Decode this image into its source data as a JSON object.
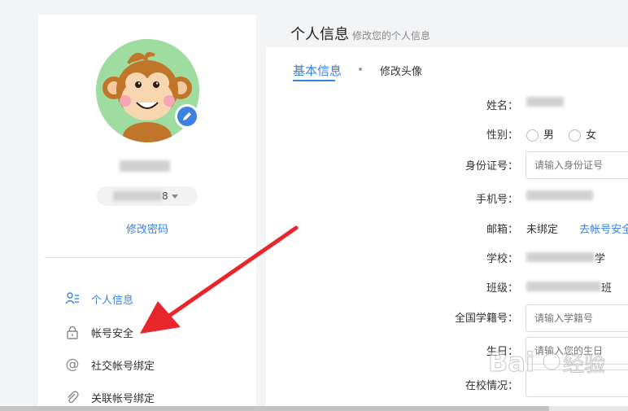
{
  "sidebar": {
    "change_password": "修改密码",
    "account_suffix": "8",
    "menu": [
      {
        "label": "个人信息",
        "icon": "user-card-icon",
        "active": true
      },
      {
        "label": "帐号安全",
        "icon": "lock-icon",
        "active": false
      },
      {
        "label": "社交帐号绑定",
        "icon": "at-icon",
        "active": false
      },
      {
        "label": "关联帐号绑定",
        "icon": "paperclip-icon",
        "active": false
      }
    ]
  },
  "main": {
    "title": "个人信息",
    "subtitle": "修改您的个人信息",
    "tabs": [
      {
        "label": "基本信息",
        "active": true
      },
      {
        "label": "修改头像",
        "active": false
      }
    ],
    "form": {
      "name_label": "姓名：",
      "gender_label": "性别：",
      "gender_male": "男",
      "gender_female": "女",
      "idcard_label": "身份证号：",
      "idcard_placeholder": "请输入身份证号",
      "phone_label": "手机号：",
      "email_label": "邮箱：",
      "email_value": "未绑定",
      "email_link": "去帐号安全",
      "school_label": "学校：",
      "school_suffix": "学",
      "class_label": "班级：",
      "class_suffix": "班",
      "student_id_label": "全国学籍号：",
      "student_id_placeholder": "请输入学籍号",
      "birthday_label": "生日：",
      "birthday_placeholder": "请输入您的生日",
      "school_status_label": "在校情况："
    }
  },
  "colors": {
    "accent": "#3b82e0",
    "arrow": "#e8262b"
  }
}
